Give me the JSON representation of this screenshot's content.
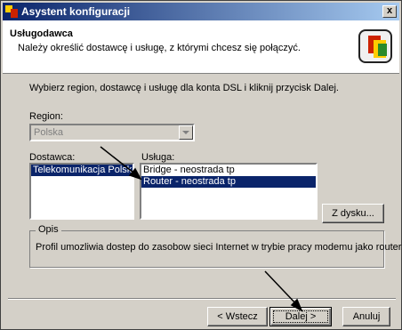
{
  "window": {
    "title": "Asystent konfiguracji",
    "close_label": "x"
  },
  "header": {
    "title": "Usługodawca",
    "subtitle": "Należy określić dostawcę i usługę, z którymi chcesz się połączyć."
  },
  "instruction": "Wybierz region, dostawcę i usługę dla konta DSL i kliknij przycisk Dalej.",
  "region": {
    "label": "Region:",
    "value": "Polska"
  },
  "provider": {
    "label": "Dostawca:",
    "items": [
      "Telekomunikacja Polska"
    ],
    "selected": 0
  },
  "service": {
    "label": "Usługa:",
    "items": [
      "Bridge - neostrada tp",
      "Router - neostrada tp"
    ],
    "selected": 1
  },
  "buttons": {
    "from_disk": "Z dysku...",
    "back": "< Wstecz",
    "next": "Dalej >",
    "cancel": "Anuluj"
  },
  "description": {
    "title": "Opis",
    "text": "Profil umozliwia dostep do zasobow sieci Internet w trybie pracy modemu jako router."
  },
  "colors": {
    "selection": "#0a246a",
    "face": "#d4d0c8",
    "title_gradient_start": "#0a246a",
    "title_gradient_end": "#a6caf0"
  },
  "icons": {
    "title": "wizard-app-icon",
    "header": "network-config-icon"
  }
}
